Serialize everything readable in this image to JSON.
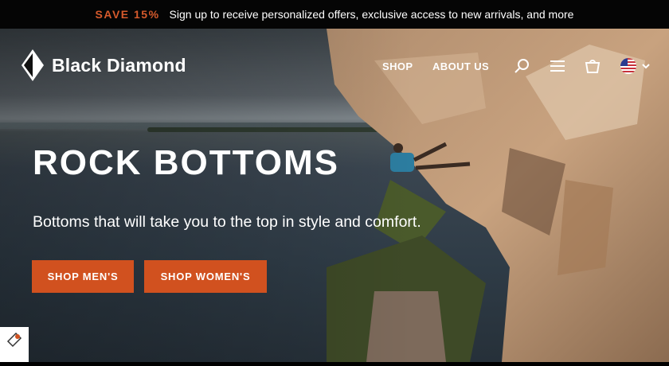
{
  "promo": {
    "badge": "SAVE 15%",
    "text": "Sign up to receive personalized offers, exclusive access to new arrivals, and more"
  },
  "header": {
    "brand": "Black Diamond",
    "nav": [
      "SHOP",
      "ABOUT US"
    ],
    "icons": [
      "search-icon",
      "menu-icon",
      "cart-icon",
      "us-flag-icon",
      "chevron-down-icon"
    ]
  },
  "hero": {
    "headline": "ROCK BOTTOMS",
    "subhead": "Bottoms that will take you to the top in style and comfort.",
    "buttons": [
      "SHOP MEN'S",
      "SHOP WOMEN'S"
    ]
  },
  "colors": {
    "accent": "#d1511f",
    "promo_accent": "#d65a2c",
    "promo_bg": "#050505"
  }
}
